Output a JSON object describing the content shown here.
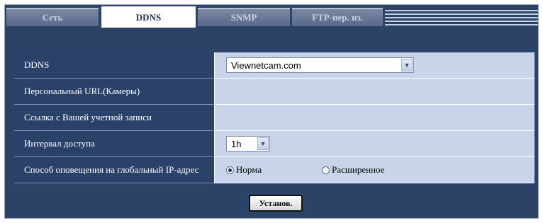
{
  "tabs": [
    {
      "label": "Сеть"
    },
    {
      "label": "DDNS"
    },
    {
      "label": "SNMP"
    },
    {
      "label": "FTP-пер. из."
    }
  ],
  "form": {
    "ddns": {
      "label": "DDNS",
      "value": "Viewnetcam.com"
    },
    "personal_url": {
      "label": "Персональный URL(Камеры)",
      "value": ""
    },
    "account_link": {
      "label": "Ссылка с Вашей учетной записи",
      "value": ""
    },
    "access_interval": {
      "label": "Интервал доступа",
      "value": "1h"
    },
    "notification": {
      "label": "Способ оповещения на глобальный IP-адрес",
      "options": [
        "Норма",
        "Расширенное"
      ],
      "selected": "Норма"
    }
  },
  "buttons": {
    "set_label": "Установ."
  },
  "colors": {
    "frame_bg": "#2c4368",
    "label_bg": "#2a4169",
    "value_bg": "#c7d4e9",
    "active_tab_bg": "#ffffff"
  }
}
